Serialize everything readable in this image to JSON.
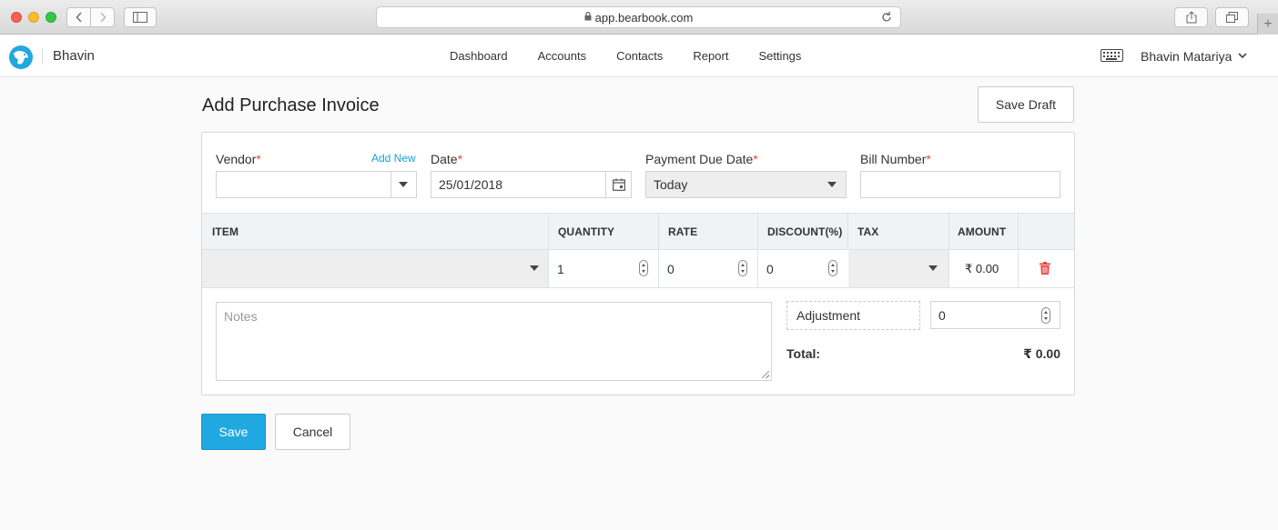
{
  "browser": {
    "url": "app.bearbook.com"
  },
  "app": {
    "brand": "Bhavin",
    "nav": [
      "Dashboard",
      "Accounts",
      "Contacts",
      "Report",
      "Settings"
    ],
    "user_name": "Bhavin Matariya"
  },
  "page": {
    "title": "Add Purchase Invoice",
    "save_draft_label": "Save Draft"
  },
  "form": {
    "vendor": {
      "label": "Vendor",
      "required_mark": "*",
      "add_new_label": "Add New",
      "value": ""
    },
    "date": {
      "label": "Date",
      "required_mark": "*",
      "value": "25/01/2018"
    },
    "payment_due": {
      "label": "Payment Due Date",
      "required_mark": "*",
      "value": "Today"
    },
    "bill_number": {
      "label": "Bill Number",
      "required_mark": "*",
      "value": ""
    }
  },
  "table": {
    "headers": [
      "ITEM",
      "QUANTITY",
      "RATE",
      "DISCOUNT(%)",
      "TAX",
      "AMOUNT"
    ],
    "rows": [
      {
        "item": "",
        "quantity": "1",
        "rate": "0",
        "discount": "0",
        "tax": "",
        "amount": "₹ 0.00"
      }
    ]
  },
  "summary": {
    "notes_placeholder": "Notes",
    "adjustment_label": "Adjustment",
    "adjustment_value": "0",
    "total_label": "Total:",
    "total_value": "₹ 0.00"
  },
  "actions": {
    "save_label": "Save",
    "cancel_label": "Cancel"
  },
  "colors": {
    "accent": "#20a9e1",
    "required": "#e8453c",
    "delete": "#e8453c"
  },
  "icons": [
    "back-icon",
    "forward-icon",
    "sidebar-icon",
    "lock-icon",
    "reload-icon",
    "share-icon",
    "tabs-icon",
    "new-tab-icon",
    "bear-logo-icon",
    "keyboard-icon",
    "chevron-down-icon",
    "calendar-icon",
    "trash-icon"
  ]
}
